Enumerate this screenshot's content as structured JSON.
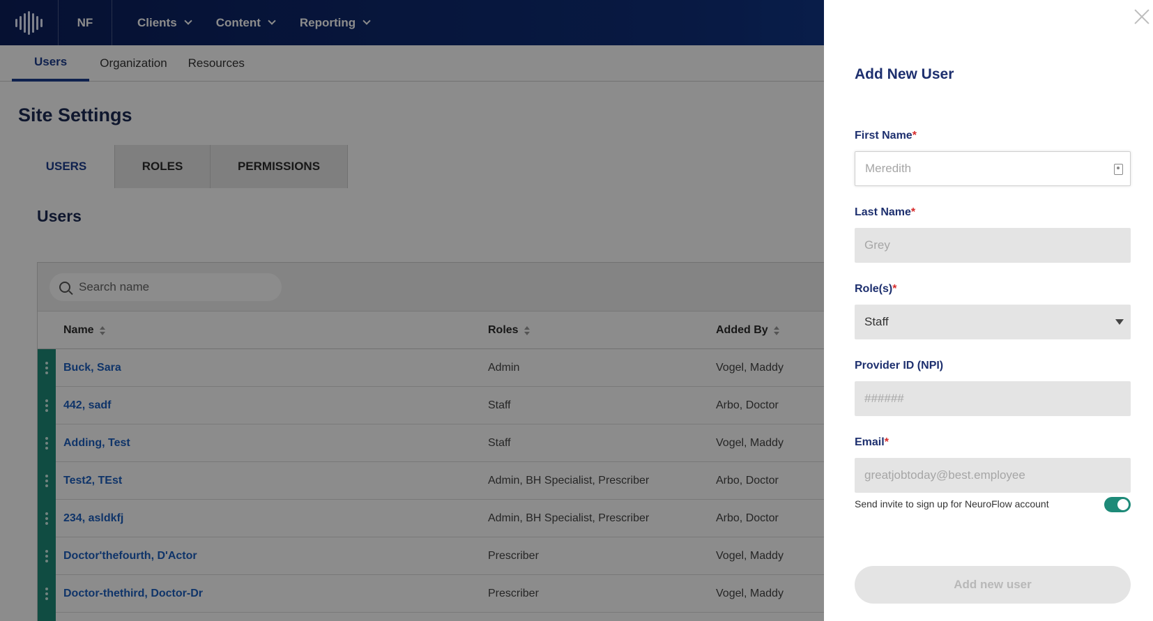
{
  "topnav": {
    "brand": "NF",
    "items": [
      {
        "label": "Clients"
      },
      {
        "label": "Content"
      },
      {
        "label": "Reporting"
      }
    ]
  },
  "subnav": {
    "tabs": [
      {
        "label": "Users"
      },
      {
        "label": "Organization"
      },
      {
        "label": "Resources"
      }
    ]
  },
  "page": {
    "title": "Site Settings",
    "tabs": [
      {
        "label": "USERS"
      },
      {
        "label": "ROLES"
      },
      {
        "label": "PERMISSIONS"
      }
    ],
    "section_title": "Users"
  },
  "table": {
    "search_placeholder": "Search name",
    "columns": [
      "Name",
      "Roles",
      "Added By"
    ],
    "rows": [
      {
        "name": "Buck, Sara",
        "roles": "Admin",
        "added_by": "Vogel, Maddy"
      },
      {
        "name": "442, sadf",
        "roles": "Staff",
        "added_by": "Arbo, Doctor"
      },
      {
        "name": "Adding, Test",
        "roles": "Staff",
        "added_by": "Vogel, Maddy"
      },
      {
        "name": "Test2, TEst",
        "roles": "Admin, BH Specialist, Prescriber",
        "added_by": "Arbo, Doctor"
      },
      {
        "name": "234, asldkfj",
        "roles": "Admin, BH Specialist, Prescriber",
        "added_by": "Arbo, Doctor"
      },
      {
        "name": "Doctor'thefourth, D'Actor",
        "roles": "Prescriber",
        "added_by": "Vogel, Maddy"
      },
      {
        "name": "Doctor-thethird, Doctor-Dr",
        "roles": "Prescriber",
        "added_by": "Vogel, Maddy"
      }
    ]
  },
  "drawer": {
    "title": "Add New User",
    "required_mark": "*",
    "first_name": {
      "label": "First Name",
      "placeholder": "Meredith"
    },
    "last_name": {
      "label": "Last Name",
      "placeholder": "Grey"
    },
    "roles": {
      "label": "Role(s)",
      "value": "Staff"
    },
    "provider_id": {
      "label": "Provider ID (NPI)",
      "placeholder": "######"
    },
    "email": {
      "label": "Email",
      "placeholder": "greatjobtoday@best.employee"
    },
    "invite_label": "Send invite to sign up for NeuroFlow account",
    "invite_enabled": true,
    "submit_label": "Add new user"
  },
  "colors": {
    "nav_bg": "#0f2f7a",
    "accent_teal": "#1e8a78",
    "title_navy": "#1d2f6e",
    "link_blue": "#1d5fbf",
    "required_red": "#d62b2b"
  }
}
